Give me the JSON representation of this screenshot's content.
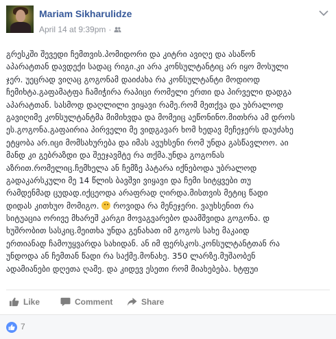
{
  "post": {
    "author": "Mariam Sikharulidze",
    "timestamp": "April 14 at 9:39pm",
    "separator": "·",
    "privacy_icon": "friends-icon",
    "menu_icon": "chevron-down-icon",
    "lines": [
      "გრესკში შევედი ჩემთვის.პომიდორი და კიტრი ავიღე და ასაწონ",
      "აპარატთან დავდექი სადაც რიგი.კი არა კონსულტანტიც არ იყო მოსული",
      "ჯერ. უეცრად ვიღაც გოგონამ დაიძახა რა კონსულტანტი მოდიოდ",
      "ჩემიხტა.გაფამატფა ჩამიჭირა რაპიცი რომელი ერთი და პირველი დადგა",
      "აპარატთან. სასმოდ დაღლილი ვიყავი რამე.რომ მეთქვა და უბრალოდ",
      "გავიღიმე კონსულტანტმა მიმიხვდა და მომეიც აეწონინო.მითხრა ამ დროს",
      "ეს.გოგონა.გაფაირია პირველი მე ვიდგავარ ხომ ხედავ მეჩეჯერს დაუძახე",
      "ეტყობა არ.იცი მომსახურება და იმას ავუხსენი რომ უნდა გასწავლოო. აი",
      "მანდ კი გებრაზდი და შეეჯავმტე რა თქმა.უნდა გოგონას",
      "აზრით.რომელიც.ჩემხელა ან ჩემზე პატარა იქნებოდა უბრალოდ",
      "გადაკარსკული მე 14 წლის ბავშვი ვიყავი და ჩემი სიტყვები თუ",
      "რამდენმად ცუდად.იქცეოდა არაფრად ღირდა.მისთვის მეტიც წადი",
      "დიდას კითხუო მომიგო.",
      "სიტუაცია ორივე მხარეშ კარგი მოვაგვარებო დაამშვიდა გოგონა. დ",
      "ხუშრობით სასკიც.მეითხა უნდა გენახათ იმ გოგოს სახე მაკაიდ",
      "ერთიანად ჩამოუყვარდა სახიდან. ან იმ ფერსკოს.კონსულტანტთან რა",
      "უნდოდა ან ჩემთან წადი რა საქმე.მონახე. 350 ლარზე.მუშაობენ",
      "ადამიანები დღეთა ღამე. და კიდევ ესეთი რომ მიახებება. ხტფუი"
    ],
    "emoji_line_suffix": " როვიდა რა მენეჯერი. ვაუხსენით რა",
    "emoji_name": "smile-emoji"
  },
  "actions": {
    "like": "Like",
    "comment": "Comment",
    "share": "Share"
  },
  "reactions": {
    "count": "7",
    "icon": "thumbs-up-icon"
  },
  "colors": {
    "author": "#365899",
    "meta": "#90949c",
    "text": "#1d2129",
    "action": "#7f7f7f",
    "like_badge": "#5890ff",
    "footer_bg": "#f6f7f9"
  }
}
